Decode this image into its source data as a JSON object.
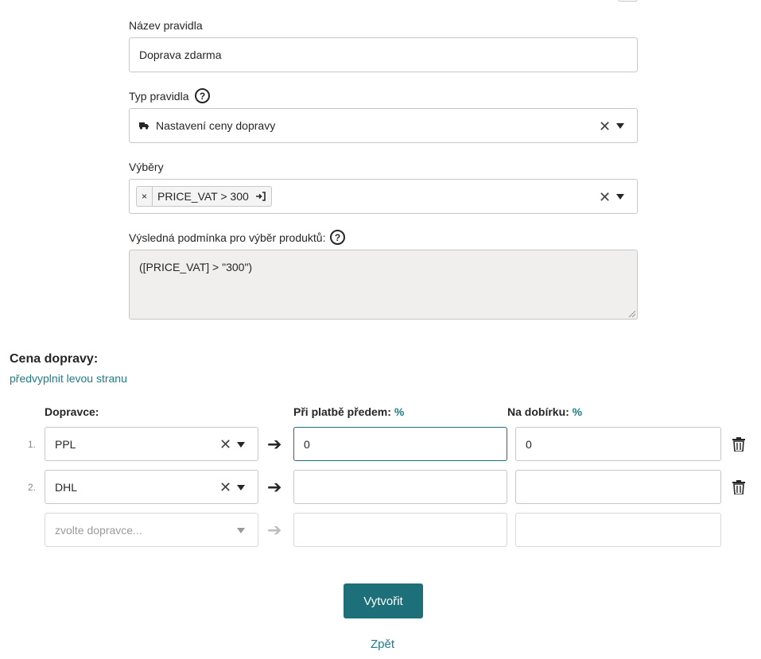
{
  "rule_name": {
    "label": "Název pravidla",
    "value": "Doprava zdarma"
  },
  "rule_type": {
    "label": "Typ pravidla",
    "help": "?",
    "value": "Nastavení ceny dopravy",
    "clear": "✕"
  },
  "selections": {
    "label": "Výběry",
    "tag": "PRICE_VAT > 300",
    "tag_remove": "×",
    "clear": "✕"
  },
  "result_condition": {
    "label": "Výsledná podmínka pro výběr produktů:",
    "help": "?",
    "value": "([PRICE_VAT] > \"300\")"
  },
  "shipping_price": {
    "title": "Cena dopravy:",
    "prefill_link": "předvyplnit levou stranu",
    "col_carrier": "Dopravce:",
    "col_prepaid": "Při platbě předem:",
    "col_prepaid_pct": "%",
    "col_cod": "Na dobírku:",
    "col_cod_pct": "%",
    "rows": [
      {
        "num": "1.",
        "carrier": "PPL",
        "clear": "✕",
        "prepaid": "0",
        "cod": "0"
      },
      {
        "num": "2.",
        "carrier": "DHL",
        "clear": "✕",
        "prepaid": "",
        "cod": ""
      }
    ],
    "new_row": {
      "placeholder": "zvolte dopravce..."
    },
    "arrow": "➔"
  },
  "actions": {
    "create": "Vytvořit",
    "back": "Zpět"
  }
}
